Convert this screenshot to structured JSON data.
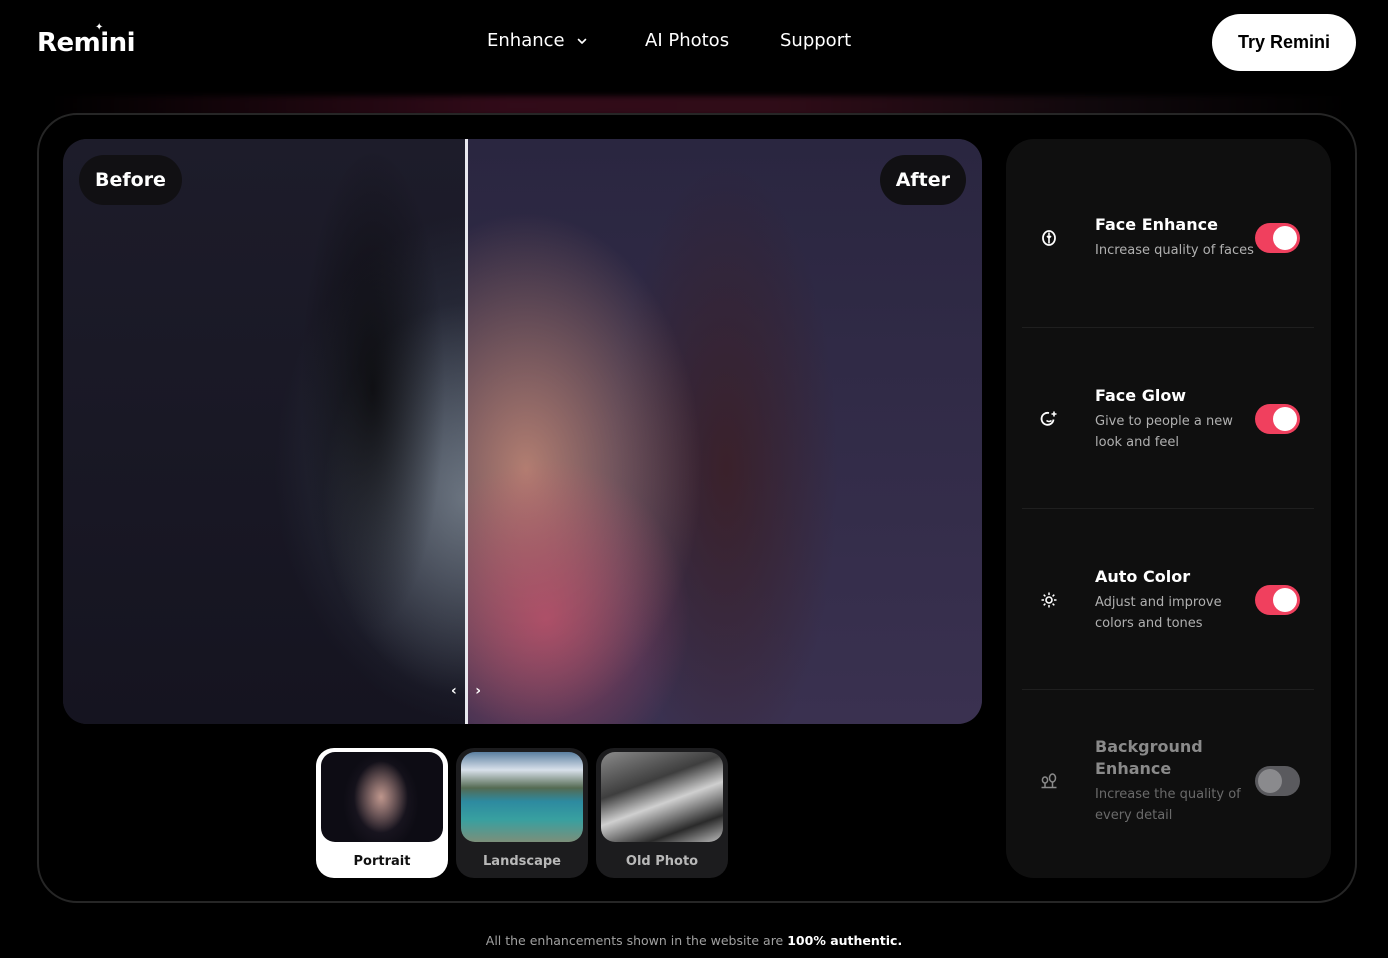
{
  "header": {
    "logo": "Remini",
    "nav": [
      {
        "label": "Enhance",
        "has_dropdown": true
      },
      {
        "label": "AI Photos"
      },
      {
        "label": "Support"
      }
    ],
    "cta_label": "Try Remini"
  },
  "compare": {
    "before_label": "Before",
    "after_label": "After",
    "slider_position": 0.44
  },
  "thumbnails": [
    {
      "label": "Portrait",
      "active": true
    },
    {
      "label": "Landscape",
      "active": false
    },
    {
      "label": "Old Photo",
      "active": false
    }
  ],
  "options": [
    {
      "title": "Face Enhance",
      "description": "Increase quality of faces",
      "icon": "face-enhance-icon",
      "enabled": true
    },
    {
      "title": "Face Glow",
      "description": "Give to people a new look and feel",
      "icon": "face-glow-icon",
      "enabled": true
    },
    {
      "title": "Auto Color",
      "description": "Adjust and improve colors and tones",
      "icon": "sun-icon",
      "enabled": true
    },
    {
      "title": "Background Enhance",
      "description": "Increase the quality of every detail",
      "icon": "trees-icon",
      "enabled": false
    }
  ],
  "colors": {
    "accent": "#f0405e",
    "panel_bg": "#0f0f0f",
    "toggle_off": "#5a5a5e"
  },
  "footer": {
    "text": "All the enhancements shown in the website are ",
    "emphasis": "100% authentic."
  }
}
